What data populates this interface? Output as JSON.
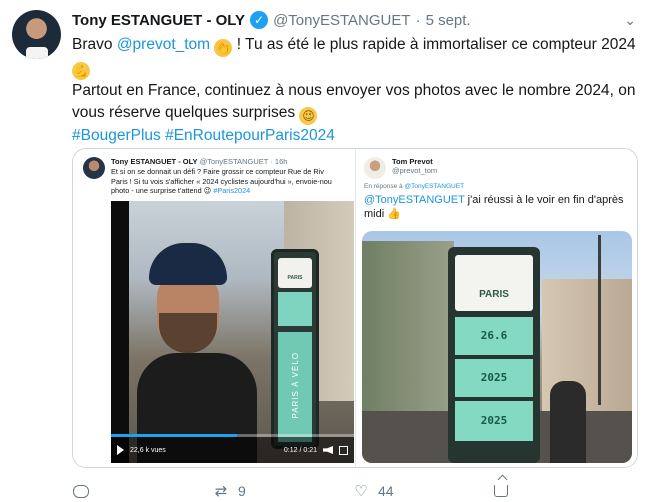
{
  "author": {
    "name": "Tony ESTANGUET - OLY",
    "handle": "@TonyESTANGUET",
    "dot": "·",
    "date": "5 sept."
  },
  "text": {
    "l1_a": "Bravo ",
    "l1_mention": "@prevot_tom",
    "l1_b": " ! Tu as été le plus rapide à immortaliser ce compteur 2024",
    "l2": "Partout en France, continuez à nous envoyer vos photos avec le nombre 2024, on vous réserve quelques surprises",
    "hashtag1": "#BougerPlus",
    "hashtag2": "#EnRoutepourParis2024"
  },
  "embed_left": {
    "name": "Tony ESTANGUET - OLY",
    "handle": "@TonyESTANGUET · 16h",
    "line1": "Et si on se donnait un défi ? Faire grossir ce compteur",
    "line1b": "Rue de Riv",
    "line2": "Paris ! Si tu vois s'afficher « 2024 cyclistes aujourd'hui », envoie-nou",
    "line3": "photo - une surprise t'attend",
    "hashtag": "#Paris2024",
    "totem_label": "PARIS",
    "totem_vertical": "PARIS À VÉLO",
    "views": "22,6 k vues",
    "time": "0:12 / 0:21"
  },
  "embed_right": {
    "name": "Tom Prevot",
    "handle": "@prevot_tom",
    "reply_prefix": "En réponse à",
    "reply_handle": "@TonyESTANGUET",
    "mention": "@TonyESTANGUET",
    "text": " j'ai réussi à le voir en fin d'après midi",
    "totem_label": "PARIS",
    "screen1": "26.6",
    "screen2": "2025",
    "screen3": "2025"
  },
  "actions": {
    "replies": "",
    "retweets": "9",
    "likes": "44"
  },
  "colors": {
    "link": "#1b95e0",
    "verified": "#1da1f2",
    "muted": "#657786"
  }
}
